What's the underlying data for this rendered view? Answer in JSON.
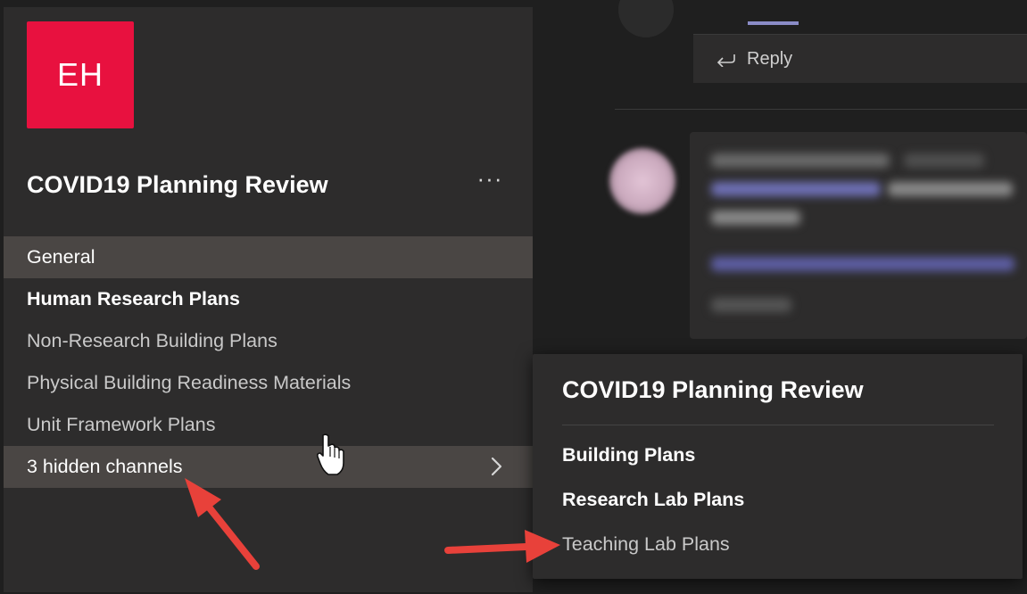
{
  "team": {
    "avatar_initials": "EH",
    "avatar_color": "#e8113f",
    "name": "COVID19 Planning Review",
    "more_options": "···"
  },
  "channels": [
    {
      "label": "General",
      "state": "selected"
    },
    {
      "label": "Human Research Plans",
      "state": "unread"
    },
    {
      "label": "Non-Research Building Plans",
      "state": "normal"
    },
    {
      "label": "Physical Building Readiness Materials",
      "state": "normal"
    },
    {
      "label": "Unit Framework Plans",
      "state": "normal"
    }
  ],
  "hidden_channels_label": "3 hidden channels",
  "chat": {
    "reply_label": "Reply",
    "accent_color": "#8b8cc7"
  },
  "flyout": {
    "title": "COVID19 Planning Review",
    "items": [
      {
        "label": "Building Plans",
        "state": "unread"
      },
      {
        "label": "Research Lab Plans",
        "state": "unread"
      },
      {
        "label": "Teaching Lab Plans",
        "state": "normal"
      }
    ]
  },
  "annotation_color": "#e8413a",
  "icons": [
    "more-options-icon",
    "chevron-right-icon",
    "reply-icon",
    "hand-cursor-icon",
    "red-arrow-icon"
  ]
}
